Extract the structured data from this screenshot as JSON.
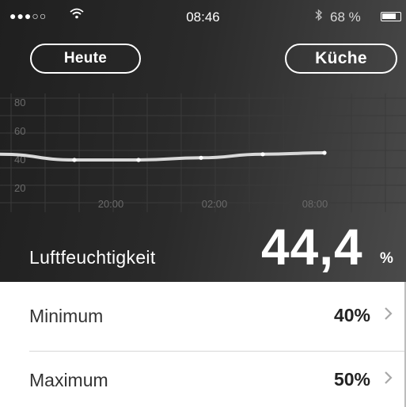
{
  "status_bar": {
    "signal": "●●●○○",
    "wifi_icon": "wifi-icon",
    "time": "08:46",
    "bluetooth_icon": "bluetooth-icon",
    "battery": "68 %"
  },
  "header": {
    "period_button": "Heute",
    "room_button": "Küche"
  },
  "chart_data": {
    "type": "line",
    "y_ticks": [
      "80",
      "60",
      "40",
      "20"
    ],
    "x_ticks": [
      "20:00",
      "02:00",
      "08:00"
    ],
    "ylim": [
      20,
      80
    ],
    "grid": true,
    "series": [
      {
        "values": [
          44,
          40,
          40,
          41.5,
          44,
          45
        ]
      }
    ]
  },
  "metric": {
    "label": "Luftfeuchtigkeit",
    "value": "44,4",
    "unit": "%"
  },
  "rows": [
    {
      "label": "Minimum",
      "value": "40%"
    },
    {
      "label": "Maximum",
      "value": "50%"
    }
  ]
}
